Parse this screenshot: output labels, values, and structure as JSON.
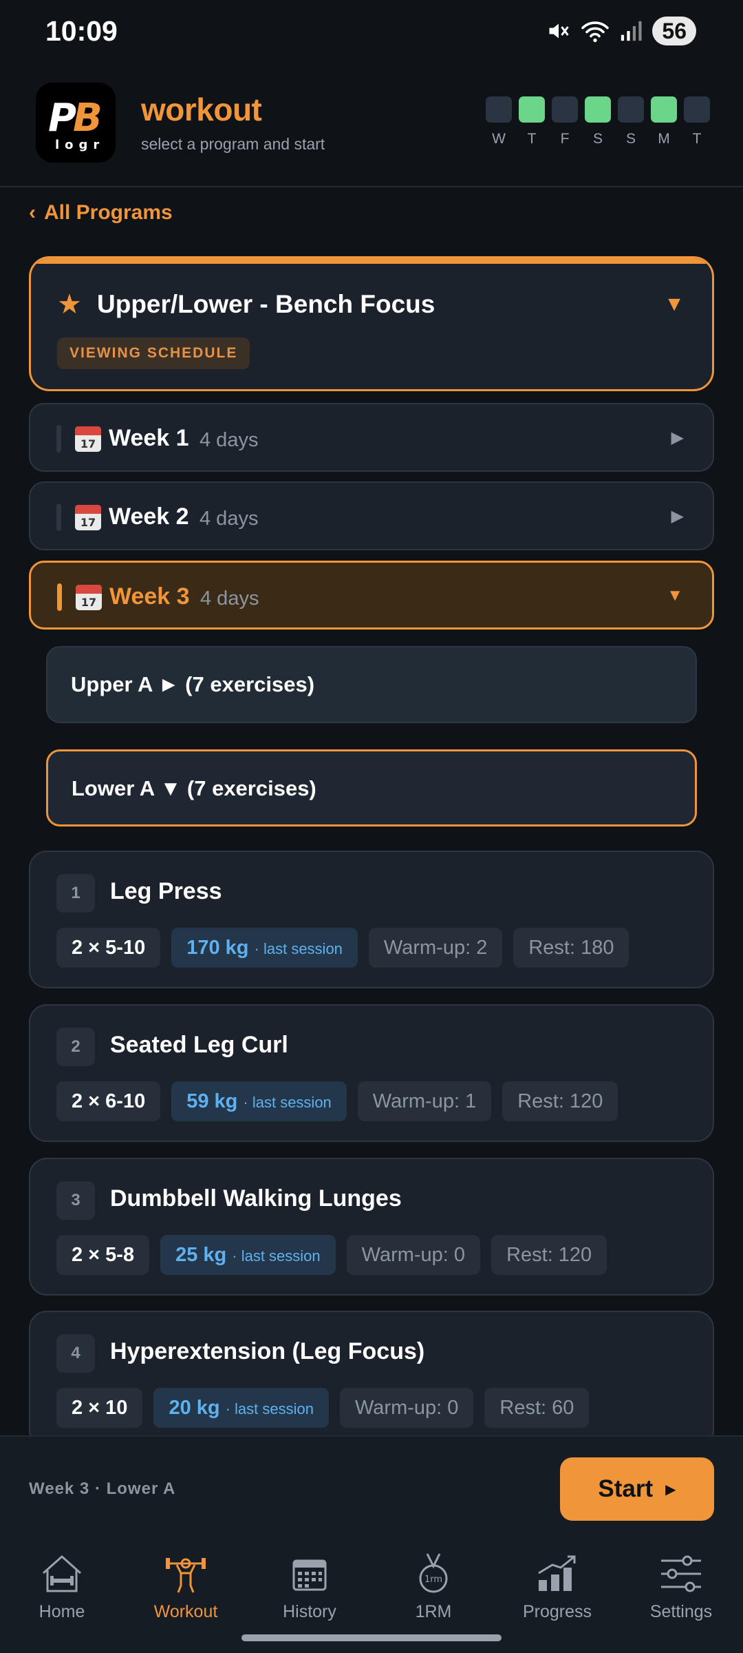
{
  "status": {
    "time": "10:09",
    "battery": "56"
  },
  "header": {
    "logo_text": "PB logr",
    "title": "workout",
    "subtitle": "select a program and start",
    "streak": [
      {
        "letter": "W",
        "active": false
      },
      {
        "letter": "T",
        "active": true
      },
      {
        "letter": "F",
        "active": false
      },
      {
        "letter": "S",
        "active": true
      },
      {
        "letter": "S",
        "active": false
      },
      {
        "letter": "M",
        "active": true
      },
      {
        "letter": "T",
        "active": false
      }
    ]
  },
  "breadcrumb": {
    "back_label": "All Programs"
  },
  "program": {
    "name": "Upper/Lower - Bench Focus",
    "badge": "VIEWING SCHEDULE"
  },
  "weeks": [
    {
      "label": "Week 1",
      "days": "4 days"
    },
    {
      "label": "Week 2",
      "days": "4 days"
    },
    {
      "label": "Week 3",
      "days": "4 days"
    }
  ],
  "days": [
    {
      "label": "Upper A ► (7 exercises)"
    },
    {
      "label": "Lower A ▼ (7 exercises)"
    }
  ],
  "exercises": [
    {
      "num": "1",
      "name": "Leg Press",
      "sets": "2 × 5-10",
      "weight": "170 kg",
      "weight_note": "· last session",
      "warmup": "Warm-up: 2",
      "rest": "Rest: 180"
    },
    {
      "num": "2",
      "name": "Seated Leg Curl",
      "sets": "2 × 6-10",
      "weight": "59 kg",
      "weight_note": "· last session",
      "warmup": "Warm-up: 1",
      "rest": "Rest: 120"
    },
    {
      "num": "3",
      "name": "Dumbbell Walking Lunges",
      "sets": "2 × 5-8",
      "weight": "25 kg",
      "weight_note": "· last session",
      "warmup": "Warm-up: 0",
      "rest": "Rest: 120"
    },
    {
      "num": "4",
      "name": "Hyperextension (Leg Focus)",
      "sets": "2 × 10",
      "weight": "20 kg",
      "weight_note": "· last session",
      "warmup": "Warm-up: 0",
      "rest": "Rest: 60"
    }
  ],
  "start_bar": {
    "summary": "Week 3 · Lower A",
    "button_label": "Start"
  },
  "nav": [
    {
      "label": "Home",
      "icon": "home-icon"
    },
    {
      "label": "Workout",
      "icon": "workout-icon"
    },
    {
      "label": "History",
      "icon": "calendar-icon"
    },
    {
      "label": "1RM",
      "icon": "medal-icon"
    },
    {
      "label": "Progress",
      "icon": "chart-icon"
    },
    {
      "label": "Settings",
      "icon": "sliders-icon"
    }
  ],
  "colors": {
    "accent": "#f0953a",
    "streak_active": "#6bd68a",
    "weight_blue": "#5eb1f0"
  }
}
